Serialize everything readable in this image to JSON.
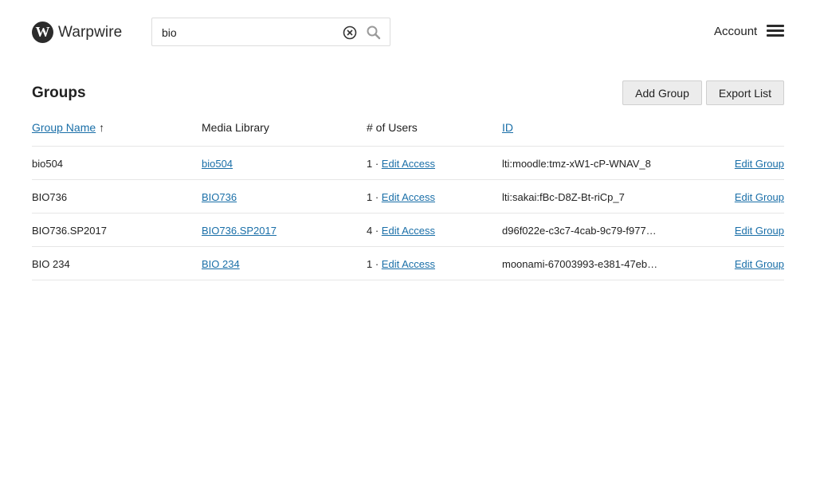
{
  "header": {
    "logo_letter": "W",
    "logo_text": "Warpwire",
    "search_value": "bio",
    "account_label": "Account"
  },
  "page": {
    "title": "Groups",
    "add_group_label": "Add Group",
    "export_list_label": "Export List"
  },
  "table": {
    "columns": {
      "group_name": "Group Name",
      "sort_arrow": "↑",
      "media_library": "Media Library",
      "num_users": "# of Users",
      "id": "ID"
    },
    "rows": [
      {
        "name": "bio504",
        "library": "bio504",
        "users": "1 ·",
        "edit_access": "Edit Access",
        "id": "lti:moodle:tmz-xW1-cP-WNAV_8",
        "edit_group": "Edit Group"
      },
      {
        "name": "BIO736",
        "library": "BIO736",
        "users": "1 ·",
        "edit_access": "Edit Access",
        "id": "lti:sakai:fBc-D8Z-Bt-riCp_7",
        "edit_group": "Edit Group"
      },
      {
        "name": "BIO736.SP2017",
        "library": "BIO736.SP2017",
        "users": "4 ·",
        "edit_access": "Edit Access",
        "id": "d96f022e-c3c7-4cab-9c79-f977…",
        "edit_group": "Edit Group"
      },
      {
        "name": "BIO 234",
        "library": "BIO 234",
        "users": "1 ·",
        "edit_access": "Edit Access",
        "id": "moonami-67003993-e381-47eb…",
        "edit_group": "Edit Group"
      }
    ]
  }
}
